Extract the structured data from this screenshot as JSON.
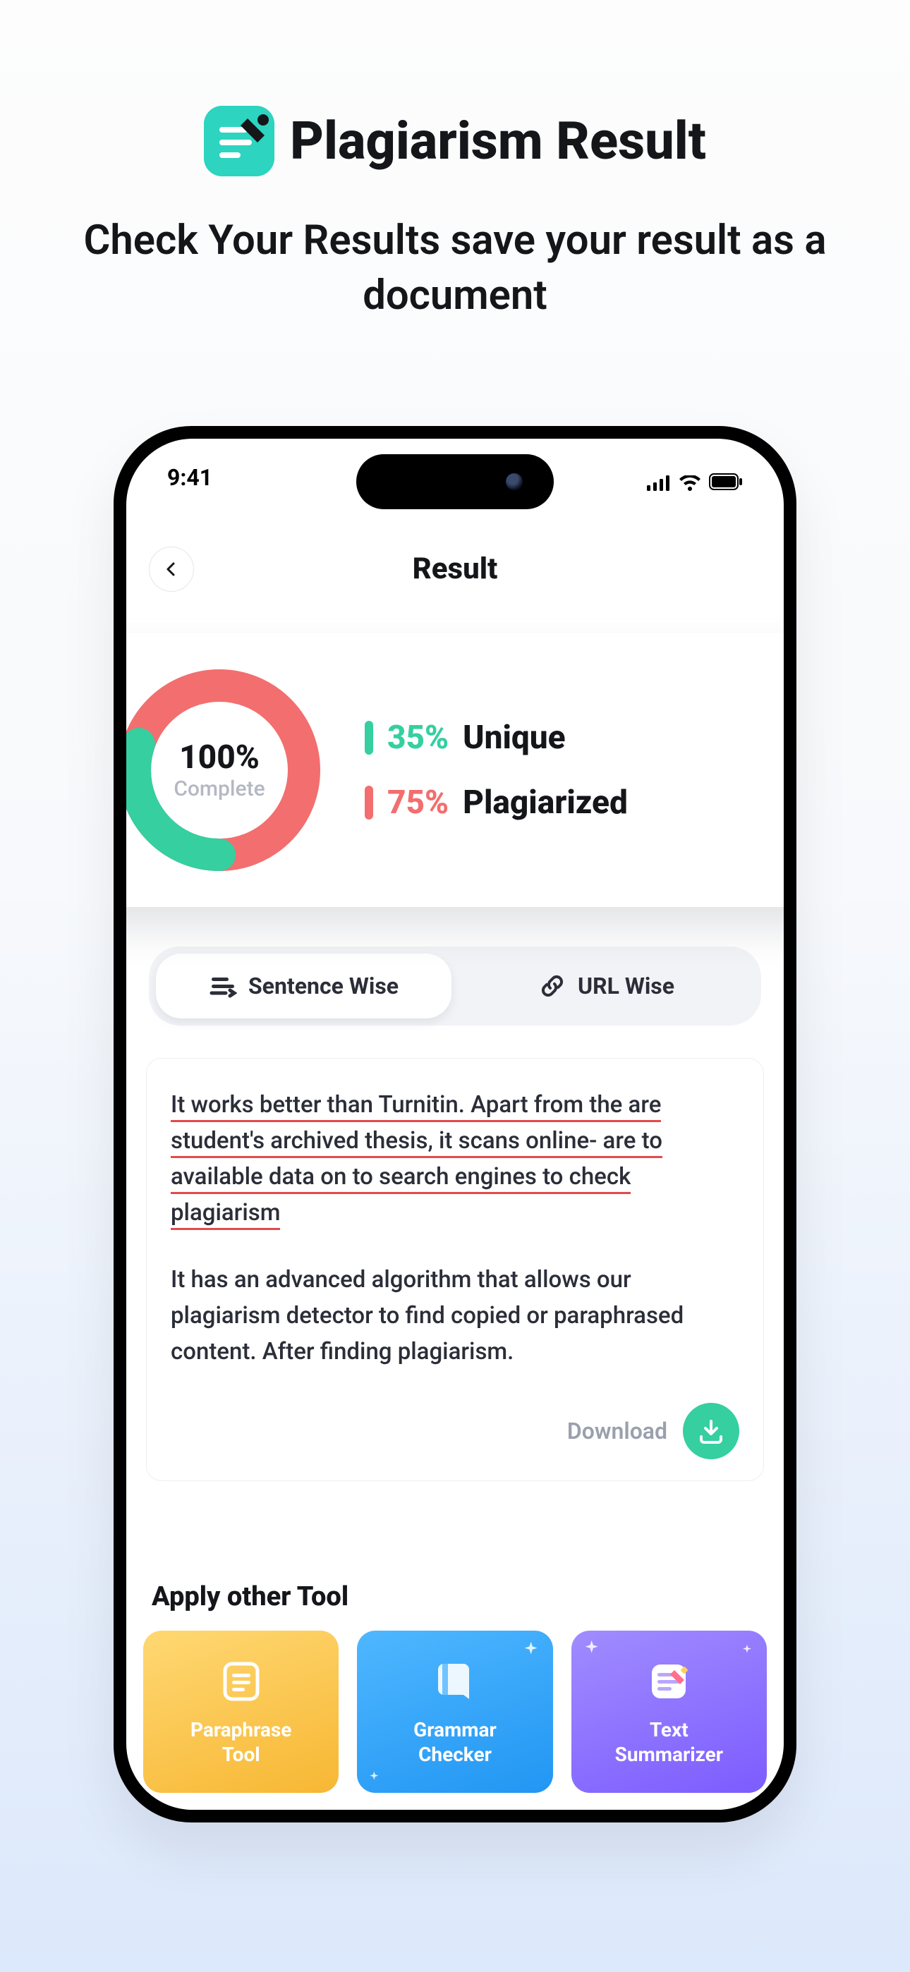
{
  "hero": {
    "title": "Plagiarism Result",
    "subtitle": "Check Your Results save your result as a document"
  },
  "status": {
    "time": "9:41"
  },
  "app": {
    "title": "Result",
    "donut": {
      "percent": "100%",
      "label": "Complete"
    },
    "unique": {
      "percent": "35%",
      "label": "Unique"
    },
    "plagiarized": {
      "percent": "75%",
      "label": "Plagiarized"
    },
    "colors": {
      "unique": "#35cfa0",
      "plagiarized": "#f36e6e"
    },
    "tabs": {
      "sentence": "Sentence Wise",
      "url": "URL Wise"
    },
    "para1_a": "It works better than Turnitin. Apart from the are",
    "para1_b": "student's archived thesis, it scans online- are to",
    "para1_c": "available data on to search engines to check",
    "para1_d": "plagiarism",
    "para2": "It has an advanced algorithm that allows our plagiarism detector to find copied or paraphrased content. After finding plagiarism.",
    "download": "Download",
    "other_tools_title": "Apply other Tool",
    "tools": [
      {
        "line1": "Paraphrase",
        "line2": "Tool"
      },
      {
        "line1": "Grammar",
        "line2": "Checker"
      },
      {
        "line1": "Text",
        "line2": "Summarizer"
      }
    ]
  }
}
